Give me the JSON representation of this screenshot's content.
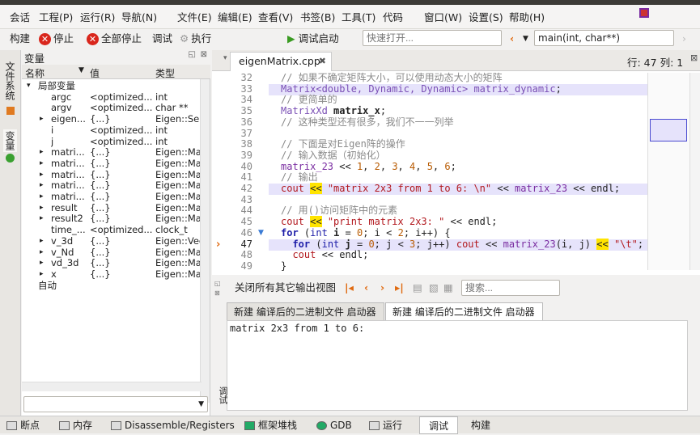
{
  "menu": [
    "会话",
    "工程(P)",
    "运行(R)",
    "导航(N)",
    "文件(E)",
    "编辑(E)",
    "查看(V)",
    "书签(B)",
    "工具(T)",
    "代码",
    "窗口(W)",
    "设置(S)",
    "帮助(H)"
  ],
  "toolbar": {
    "build": "构建",
    "stop": "停止",
    "stop_all": "全部停止",
    "debug": "调试",
    "execute": "执行",
    "debug_launch": "调试启动",
    "quick_open_placeholder": "快速打开...",
    "function": "main(int, char**)"
  },
  "lefttabs": {
    "files": "文件系统",
    "vars": "变量"
  },
  "vars": {
    "title": "变量",
    "col_name": "名称",
    "col_value": "值",
    "col_type": "类型",
    "rows": [
      {
        "exp": "▾",
        "name": "局部变量",
        "value": "",
        "type": ""
      },
      {
        "exp": "",
        "name": "argc",
        "value": "<optimized...",
        "type": "int"
      },
      {
        "exp": "",
        "name": "argv",
        "value": "<optimized...",
        "type": "char **"
      },
      {
        "exp": "▸",
        "name": "eigen...",
        "value": "{...}",
        "type": "Eigen::Self..."
      },
      {
        "exp": "",
        "name": "i",
        "value": "<optimized...",
        "type": "int"
      },
      {
        "exp": "",
        "name": "j",
        "value": "<optimized...",
        "type": "int"
      },
      {
        "exp": "▸",
        "name": "matri...",
        "value": "{...}",
        "type": "Eigen::Matr..."
      },
      {
        "exp": "▸",
        "name": "matri...",
        "value": "{...}",
        "type": "Eigen::Matr..."
      },
      {
        "exp": "▸",
        "name": "matri...",
        "value": "{...}",
        "type": "Eigen::Matr..."
      },
      {
        "exp": "▸",
        "name": "matri...",
        "value": "{...}",
        "type": "Eigen::Matr..."
      },
      {
        "exp": "▸",
        "name": "matri...",
        "value": "{...}",
        "type": "Eigen::Matr..."
      },
      {
        "exp": "▸",
        "name": "result",
        "value": "{...}",
        "type": "Eigen::Matr..."
      },
      {
        "exp": "▸",
        "name": "result2",
        "value": "{...}",
        "type": "Eigen::Matr..."
      },
      {
        "exp": "",
        "name": "time_...",
        "value": "<optimized...",
        "type": "clock_t"
      },
      {
        "exp": "▸",
        "name": "v_3d",
        "value": "{...}",
        "type": "Eigen::Vect..."
      },
      {
        "exp": "▸",
        "name": "v_Nd",
        "value": "{...}",
        "type": "Eigen::Matr..."
      },
      {
        "exp": "▸",
        "name": "vd_3d",
        "value": "{...}",
        "type": "Eigen::Matr..."
      },
      {
        "exp": "▸",
        "name": "x",
        "value": "{...}",
        "type": "Eigen::Matr..."
      },
      {
        "exp": "",
        "name": "自动",
        "value": "",
        "type": ""
      }
    ]
  },
  "editor": {
    "tab": "eigenMatrix.cpp",
    "position": "行: 47 列: 1",
    "lines": [
      {
        "n": "32",
        "html": "<span class='cm'>// 如果不确定矩阵大小，可以使用动态大小的矩阵</span>"
      },
      {
        "n": "33",
        "html": "<span class='ty'>Matrix</span><span class='ty'>&lt;double, Dynamic, Dynamic&gt;</span> <span class='ty'>matrix_dynamic</span>;"
      },
      {
        "n": "34",
        "html": "<span class='cm'>// 更简单的</span>"
      },
      {
        "n": "35",
        "html": "<span class='ty'>MatrixXd</span> <b>matrix_x</b>;"
      },
      {
        "n": "36",
        "html": "<span class='cm'>// 这种类型还有很多，我们不一一列举</span>"
      },
      {
        "n": "37",
        "html": ""
      },
      {
        "n": "38",
        "html": "<span class='cm'>// 下面是对Eigen阵的操作</span>"
      },
      {
        "n": "39",
        "html": "<span class='cm'>// 输入数据（初始化）</span>"
      },
      {
        "n": "40",
        "html": "<span class='fn'>matrix_23</span> &lt;&lt; <span class='nm'>1</span>, <span class='nm'>2</span>, <span class='nm'>3</span>, <span class='nm'>4</span>, <span class='nm'>5</span>, <span class='nm'>6</span>;"
      },
      {
        "n": "41",
        "html": "<span class='cm'>// 输出</span>"
      },
      {
        "n": "42",
        "html": "<span class='st'>cout</span> <span style='background:#ffe400'>&lt;&lt;</span> <span class='st'>\"matrix 2x3 from 1 to 6: \\n\"</span> &lt;&lt; <span class='fn'>matrix_23</span> &lt;&lt; endl;"
      },
      {
        "n": "43",
        "html": ""
      },
      {
        "n": "44",
        "html": "<span class='cm'>// 用()访问矩阵中的元素</span>"
      },
      {
        "n": "45",
        "html": "<span class='st'>cout</span> <span style='background:#ffe400'>&lt;&lt;</span> <span class='st'>\"print matrix 2x3: \"</span> &lt;&lt; endl;"
      },
      {
        "n": "46",
        "html": "<span class='kw'>for</span> (<span class='kw' style='font-weight:normal'>int</span> <b>i</b> = <span class='nm'>0</span>; i &lt; <span class='nm'>2</span>; i++) {"
      },
      {
        "n": "47",
        "html": "  <span class='kw'>for</span> (<span class='kw' style='font-weight:normal'>int</span> <b>j</b> = <span class='nm'>0</span>; j &lt; <span class='nm'>3</span>; j++) <span class='st'>cout</span> &lt;&lt; <span class='fn'>matrix_23</span>(i, j) <span style='background:#ffe400'>&lt;&lt;</span> <span class='st'>\"\\t\"</span>;"
      },
      {
        "n": "48",
        "html": "  <span class='st'>cout</span> &lt;&lt; endl;"
      },
      {
        "n": "49",
        "html": "}"
      }
    ]
  },
  "output": {
    "close_others": "关闭所有其它输出视图",
    "search_placeholder": "搜索...",
    "tab1": "新建 编译后的二进制文件 启动器",
    "tab2": "新建 编译后的二进制文件 启动器",
    "text": "matrix 2x3 from 1 to 6:",
    "side_label": "调试"
  },
  "bottom": [
    "断点",
    "内存",
    "Disassemble/Registers",
    "框架堆栈",
    "GDB",
    "运行",
    "调试",
    "构建"
  ]
}
